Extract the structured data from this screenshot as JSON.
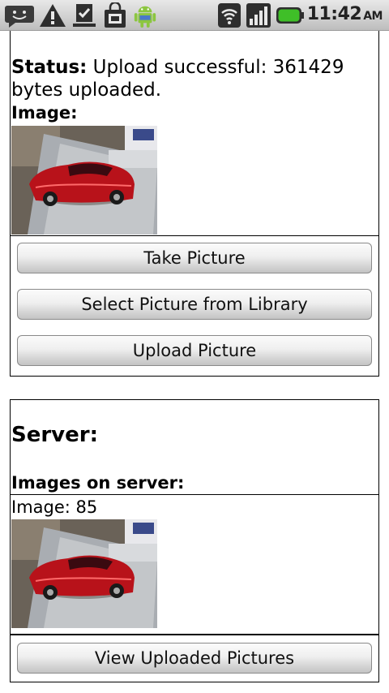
{
  "status_bar": {
    "icons": [
      "messaging-icon",
      "warning-icon",
      "download-done-icon",
      "market-icon",
      "android-icon",
      "wifi-icon",
      "signal-icon",
      "battery-icon"
    ],
    "time": "11:42",
    "ampm": "AM",
    "battery_color": "#3fbf28"
  },
  "upload_panel": {
    "status_label": "Status:",
    "status_text": "Upload successful: 361429 bytes uploaded.",
    "image_label": "Image:"
  },
  "actions": {
    "take_picture": "Take Picture",
    "select_picture": "Select Picture from Library",
    "upload_picture": "Upload Picture"
  },
  "server_panel": {
    "heading": "Server:",
    "images_heading": "Images on server:",
    "image_caption": "Image: 85",
    "view_button": "View Uploaded Pictures"
  }
}
